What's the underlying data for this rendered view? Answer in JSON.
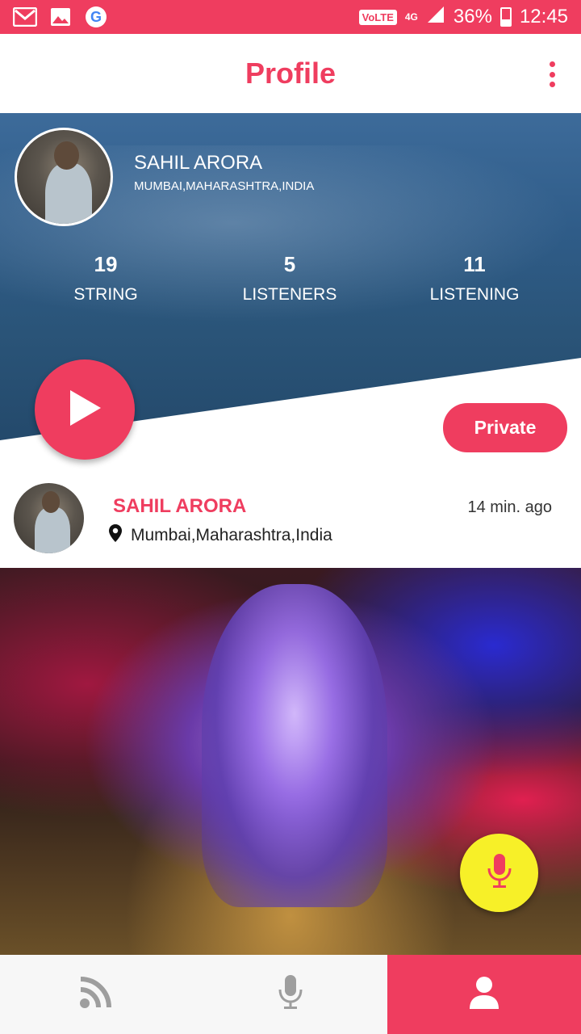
{
  "status_bar": {
    "volte": "VoLTE",
    "network": "4G",
    "battery": "36%",
    "battery_level": 0.36,
    "time": "12:45",
    "icons": [
      "gmail-icon",
      "gallery-icon",
      "google-icon",
      "signal-icon",
      "battery-icon"
    ]
  },
  "app_bar": {
    "title": "Profile",
    "menu_icon": "more-vertical-icon"
  },
  "profile": {
    "name": "SAHIL ARORA",
    "location": "MUMBAI,MAHARASHTRA,INDIA",
    "stats": [
      {
        "value": "19",
        "label": "STRING"
      },
      {
        "value": "5",
        "label": "LISTENERS"
      },
      {
        "value": "11",
        "label": "LISTENING"
      }
    ],
    "private_label": "Private"
  },
  "post": {
    "author": "SAHIL ARORA",
    "location": "Mumbai,Maharashtra,India",
    "time": "14 min. ago"
  },
  "bottom_nav": {
    "items": [
      {
        "icon": "feed-icon",
        "active": false
      },
      {
        "icon": "mic-icon",
        "active": false
      },
      {
        "icon": "profile-icon",
        "active": true
      }
    ]
  },
  "colors": {
    "accent": "#ef3d5f",
    "fab_yellow": "#f7f028",
    "nav_inactive": "#9e9e9e"
  }
}
